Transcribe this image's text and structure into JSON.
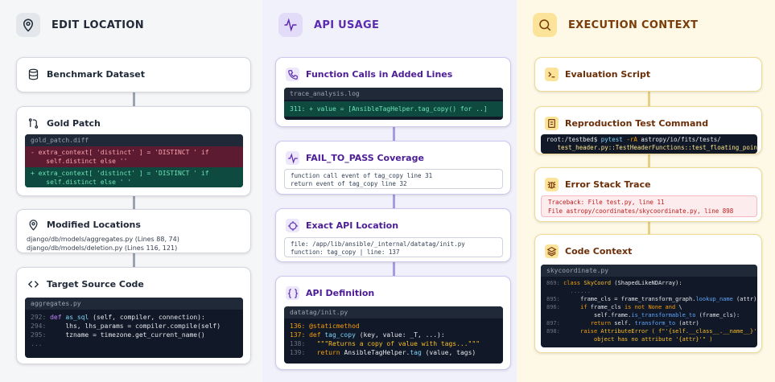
{
  "columns": {
    "edit_location": {
      "title": "EDIT LOCATION",
      "icon": "map-pin-icon"
    },
    "api_usage": {
      "title": "API USAGE",
      "icon": "pulse-icon"
    },
    "execution_context": {
      "title": "EXECUTION CONTEXT",
      "icon": "search-icon"
    }
  },
  "colors": {
    "edit_bg": "#f5f6f8",
    "api_bg": "#f1f1fb",
    "exec_bg": "#fdf9e6",
    "api_accent": "#5b2bb0",
    "exec_accent": "#7a3c0a",
    "code_bg": "#111827",
    "removed_line": "#5c1b31",
    "added_line": "#0e4a40"
  },
  "edit": {
    "benchmark": {
      "title": "Benchmark Dataset",
      "icon": "database-icon"
    },
    "gold_patch": {
      "title": "Gold Patch",
      "icon": "git-branch-icon",
      "file": "gold_patch.diff",
      "removed": [
        "- extra_context[ 'distinct' ] = 'DISTINCT ' if",
        "    self.distinct else ''"
      ],
      "added": [
        "+ extra_context[ 'distinct' ] = 'DISTINCT ' if",
        "    self.distinct else ' '"
      ]
    },
    "modified": {
      "title": "Modified Locations",
      "icon": "map-pin-icon",
      "lines": [
        "django/db/models/aggregates.py (Lines 88, 74)",
        "django/db/models/deletion.py (Lines 116, 121)"
      ]
    },
    "target": {
      "title": "Target Source Code",
      "icon": "code-brackets-icon",
      "file": "aggregates.py",
      "l1": {
        "num": "292:",
        "kw": "def",
        "fn": "as_sql",
        "rest": " (self, compiler, connection):"
      },
      "l2": {
        "num": "294:",
        "text": "     lhs, lhs_params = compiler.compile(self)"
      },
      "l3": {
        "num": "295:",
        "text": "     tzname = timezone.get_current_name()"
      },
      "l4": {
        "text": "..."
      }
    }
  },
  "api": {
    "function_calls": {
      "title": "Function Calls in Added Lines",
      "icon": "phone-icon",
      "file": "trace_analysis.log",
      "line": "311: + value = [AnsibleTagHelper.tag_copy() for ..]"
    },
    "fail_to_pass": {
      "title": "FAIL_TO_PASS Coverage",
      "icon": "pulse-icon",
      "lines": [
        "function call event of tag_copy line 31",
        "return event of tag_copy line 32"
      ]
    },
    "exact": {
      "title": "Exact API Location",
      "icon": "crosshair-icon",
      "lines": [
        "file: /app/lib/ansible/_internal/datatag/init.py",
        "function: tag_copy | line: 137"
      ]
    },
    "definition": {
      "title": "API Definition",
      "icon": "curly-braces-icon",
      "file": "datatag/init.py",
      "l1": {
        "num": "136:",
        "text": " @staticmethod"
      },
      "l2": {
        "num": "137:",
        "kw": " def",
        "fn": " tag_copy",
        "rest": " (key, value: _T, ...):"
      },
      "l3": {
        "num": "138:",
        "text": "   \"\"\"Returns a copy of value with tags...\"\"\""
      },
      "l4": {
        "num": "139:",
        "kw": "   return",
        "rest": " AnsibleTagHelper.",
        "fn": "tag",
        "rest2": " (value, tags)"
      }
    }
  },
  "exec": {
    "eval_script": {
      "title": "Evaluation Script",
      "icon": "terminal-icon"
    },
    "repro": {
      "title": "Reproduction Test Command",
      "icon": "file-icon",
      "l1_prefix": "root:/testbed$ ",
      "l1_cmd": "pytest",
      "l1_flag": " -rA",
      "l1_rest": " astropy/io/fits/tests/",
      "l2": "   test_header.py::TestHeaderFunctions::test_floating_point"
    },
    "stack": {
      "title": "Error Stack Trace",
      "icon": "bug-icon",
      "lines": [
        "Traceback: File test.py, line 11",
        "File astropy/coordinates/skycoordinate.py, line 898"
      ]
    },
    "context": {
      "title": "Code Context",
      "icon": "layers-icon",
      "file": "skycoordinate.py",
      "l1": {
        "num": "869:",
        "kw": " class",
        "cls": " SkyCoord",
        "rest": " (ShapedLikeNDArray):"
      },
      "l2": {
        "text": "       ......"
      },
      "l3": {
        "num": "895:",
        "text": "      frame_cls = frame_transform_graph.",
        "attr": "lookup_name",
        "rest": " (attr)"
      },
      "l4": {
        "num": "896:",
        "kw": "      if",
        "text": " frame_cls",
        "kw2": " is not None and",
        "rest": " \\"
      },
      "l5": {
        "text": "              self.frame.",
        "attr": "is_transformable_to",
        "rest": " (frame_cls):"
      },
      "l6": {
        "num": "897:",
        "kw": "         return",
        "text": " self.",
        "attr": " transform_to",
        "rest": " (attr)"
      },
      "l7": {
        "num": "898:",
        "kw": "      raise",
        "cls": " AttributeError",
        "str": " ( f\"'{self.__class__.__name__}'"
      },
      "l8": {
        "str": "              object has no attribute '{attr}'\" )"
      }
    }
  }
}
